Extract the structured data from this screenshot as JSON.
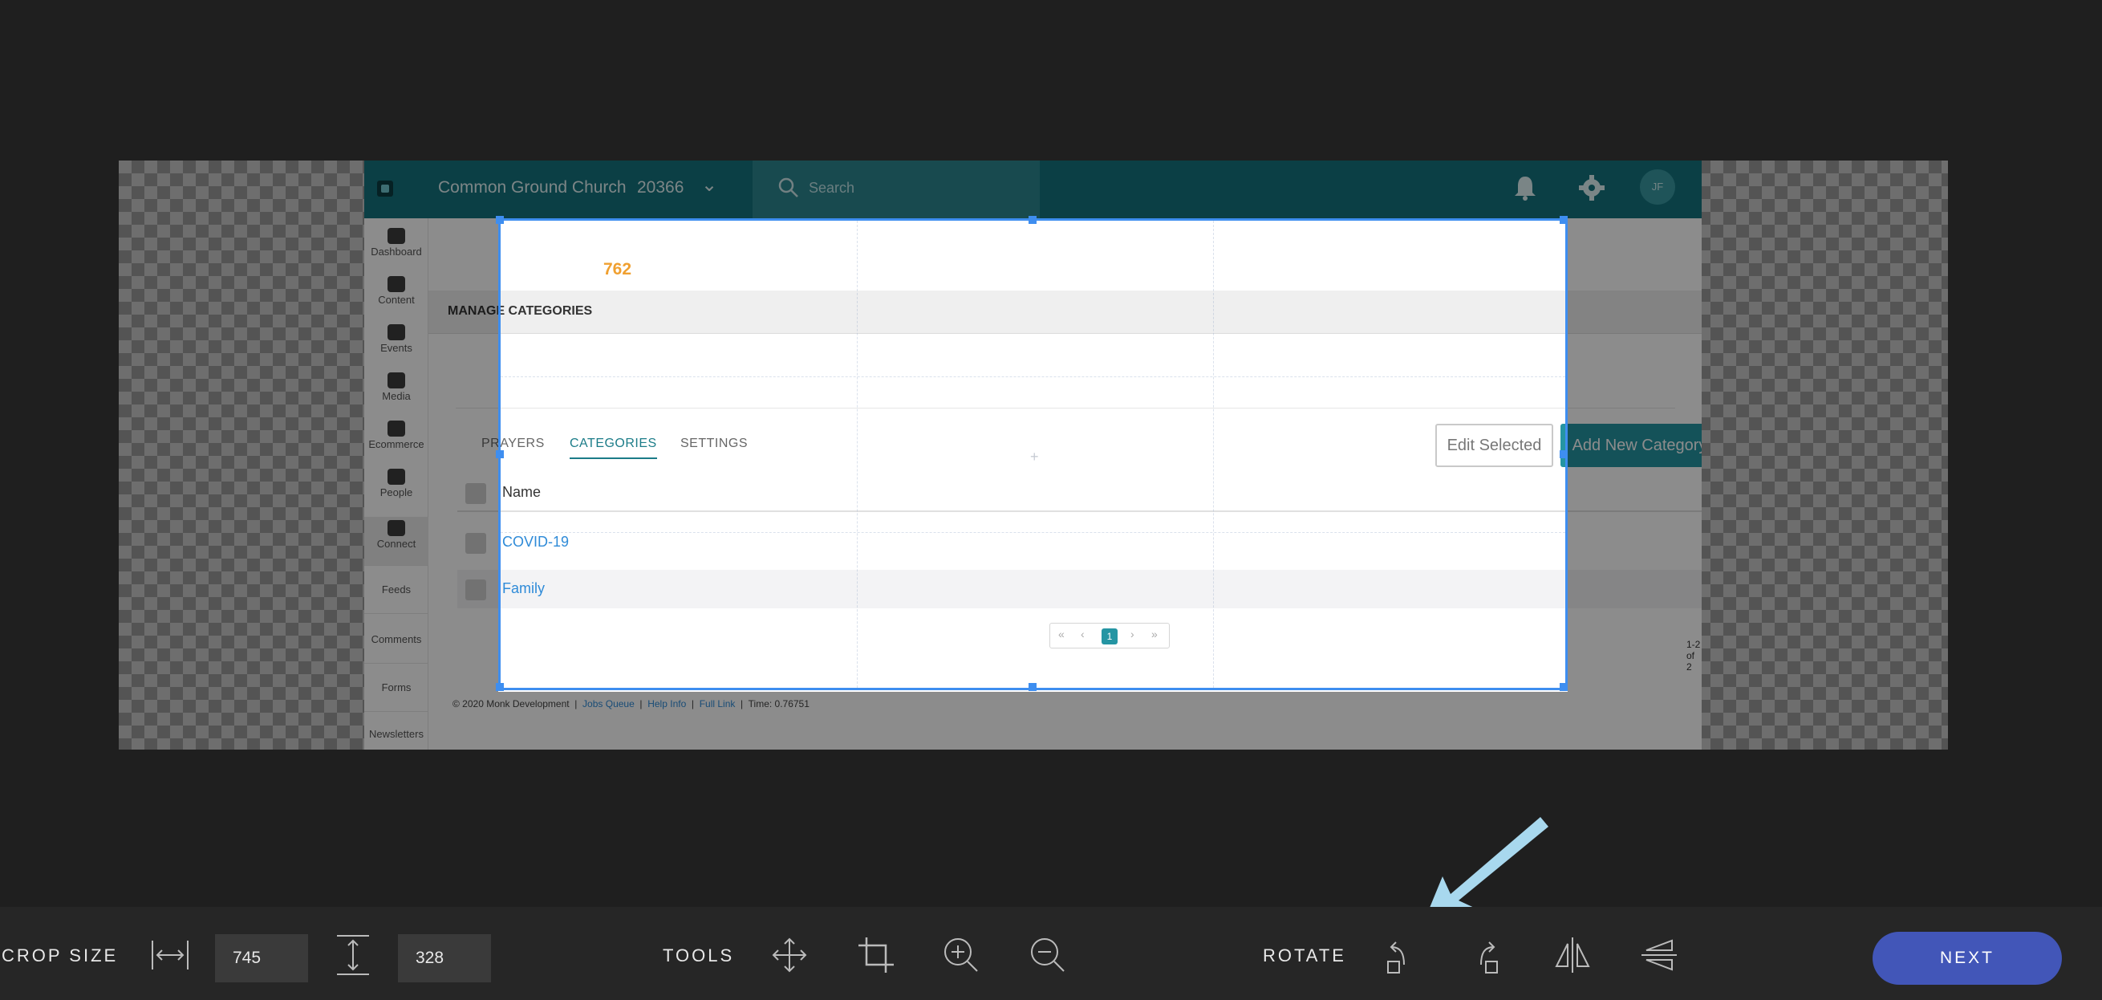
{
  "screenshot": {
    "org_name": "Common Ground Church",
    "org_id": "20366",
    "search_placeholder": "Search",
    "avatar_initials": "JF",
    "sidebar": [
      {
        "label": "Dashboard",
        "icon": "dashboard-icon"
      },
      {
        "label": "Content",
        "icon": "content-icon"
      },
      {
        "label": "Events",
        "icon": "calendar-icon"
      },
      {
        "label": "Media",
        "icon": "media-icon"
      },
      {
        "label": "Ecommerce",
        "icon": "cart-icon"
      },
      {
        "label": "People",
        "icon": "people-icon"
      },
      {
        "label": "Connect",
        "icon": "plug-icon"
      }
    ],
    "sidebar_sub": [
      "Feeds",
      "Comments",
      "Forms",
      "Newsletters"
    ],
    "stat_number": "762",
    "section_title": "MANAGE CATEGORIES",
    "tabs": [
      "PRAYERS",
      "CATEGORIES",
      "SETTINGS"
    ],
    "active_tab": "CATEGORIES",
    "edit_button": "Edit Selected",
    "add_button": "Add New Category",
    "table": {
      "header": "Name",
      "rows": [
        "COVID-19",
        "Family"
      ]
    },
    "pagination": {
      "current": "1",
      "count_text": "1-2 of 2"
    },
    "footer": {
      "copyright": "© 2020 Monk Development",
      "links": [
        "Jobs Queue",
        "Help Info",
        "Full Link"
      ],
      "time": "Time: 0.76751"
    }
  },
  "toolbar": {
    "crop_size_label": "CROP SIZE",
    "width_value": "745",
    "height_value": "328",
    "tools_label": "TOOLS",
    "rotate_label": "ROTATE",
    "next_label": "NEXT",
    "icons": [
      "width-arrows-icon",
      "height-arrows-icon",
      "move-icon",
      "crop-icon",
      "zoom-in-icon",
      "zoom-out-icon",
      "rotate-left-icon",
      "rotate-right-icon",
      "flip-horizontal-icon",
      "flip-vertical-icon"
    ]
  },
  "colors": {
    "background": "#1f1f1f",
    "toolbar": "#262626",
    "crop_border": "#3e8ef0",
    "next_button": "#4256b8",
    "app_header": "#14747f",
    "accent": "#2595a3",
    "arrow": "#a8d8ee"
  }
}
